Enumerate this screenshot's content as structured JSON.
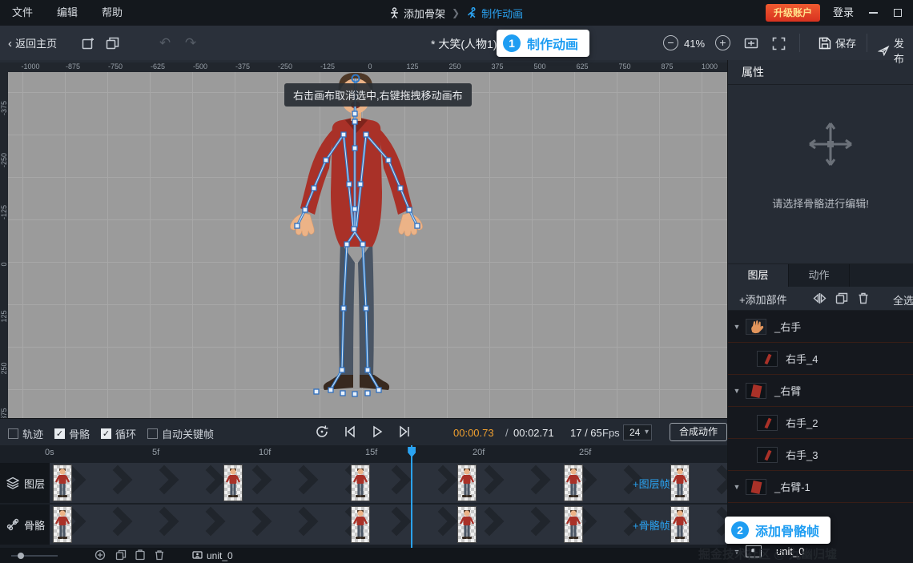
{
  "menubar": {
    "items": [
      "文件",
      "编辑",
      "帮助"
    ],
    "step_add_skeleton": "添加骨架",
    "step_make_animation": "制作动画",
    "upgrade_label": "升级账户",
    "login_label": "登录"
  },
  "toolbar": {
    "back_label": "返回主页",
    "doc_title": "* 大笑(人物1)",
    "zoom_value": "41%",
    "save_label": "保存",
    "publish_label": "发布"
  },
  "callouts": {
    "step1_num": "1",
    "step1_label": "制作动画",
    "step2_num": "2",
    "step2_label": "添加骨骼帧"
  },
  "canvas": {
    "tooltip": "右击画布取消选中,右键拖拽移动画布",
    "h_ruler": [
      "-1000",
      "-875",
      "-750",
      "-625",
      "-500",
      "-375",
      "-250",
      "-125",
      "0",
      "125",
      "250",
      "375",
      "500",
      "625",
      "750",
      "875",
      "1000"
    ],
    "v_ruler": [
      "-375",
      "-250",
      "-125",
      "0",
      "125",
      "250",
      "375"
    ]
  },
  "properties": {
    "title": "属性",
    "hint": "请选择骨骼进行编辑!"
  },
  "layers_panel": {
    "tab_layers": "图层",
    "tab_actions": "动作",
    "add_part_label": "+添加部件",
    "select_all_label": "全选",
    "items": [
      {
        "label": "_右手"
      },
      {
        "label": "右手_4"
      },
      {
        "label": "_右臂"
      },
      {
        "label": "右手_2"
      },
      {
        "label": "右手_3"
      },
      {
        "label": "_右臂-1"
      },
      {
        "label": "unit_0"
      }
    ]
  },
  "timeline": {
    "toggles": [
      {
        "label": "轨迹",
        "checked": false
      },
      {
        "label": "骨骼",
        "checked": true
      },
      {
        "label": "循环",
        "checked": true
      },
      {
        "label": "自动关键帧",
        "checked": false
      }
    ],
    "time_current": "00:00.73",
    "time_sep": "/",
    "time_total": "00:02.71",
    "frame_display": "17 / 65",
    "fps_label": "Fps",
    "fps_value": "24",
    "compose_label": "合成动作",
    "ruler": [
      "0s",
      "5f",
      "10f",
      "15f",
      "20f",
      "25f"
    ],
    "playhead_frame": 17,
    "rows": [
      {
        "label": "图层",
        "add_label": "+图层帧"
      },
      {
        "label": "骨骼",
        "add_label": "+骨骼帧"
      }
    ],
    "keyframes": {
      "layers": [
        0,
        8,
        14,
        19,
        24,
        29
      ],
      "bones": [
        0,
        14,
        19,
        24,
        29
      ]
    },
    "unit_tab": "unit_0"
  },
  "watermark": "掘金技术社区 @ 九幽归墟"
}
